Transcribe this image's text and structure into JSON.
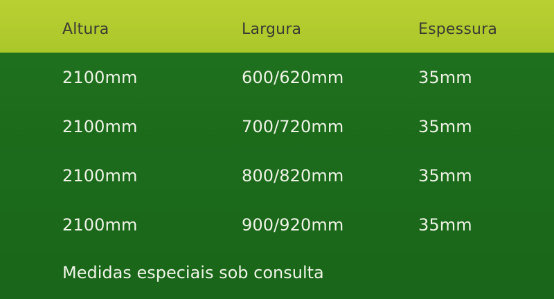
{
  "table": {
    "headers": [
      "Altura",
      "Largura",
      "Espessura"
    ],
    "rows": [
      [
        "2100mm",
        "600/620mm",
        "35mm"
      ],
      [
        "2100mm",
        "700/720mm",
        "35mm"
      ],
      [
        "2100mm",
        "800/820mm",
        "35mm"
      ],
      [
        "2100mm",
        "900/920mm",
        "35mm"
      ]
    ]
  },
  "note": "Medidas especiais sob consulta",
  "colors": {
    "header_bg": "#b3cc2c",
    "body_bg": "#1e6e1c",
    "header_text": "#3b3a33",
    "body_text": "#eef3e6"
  }
}
